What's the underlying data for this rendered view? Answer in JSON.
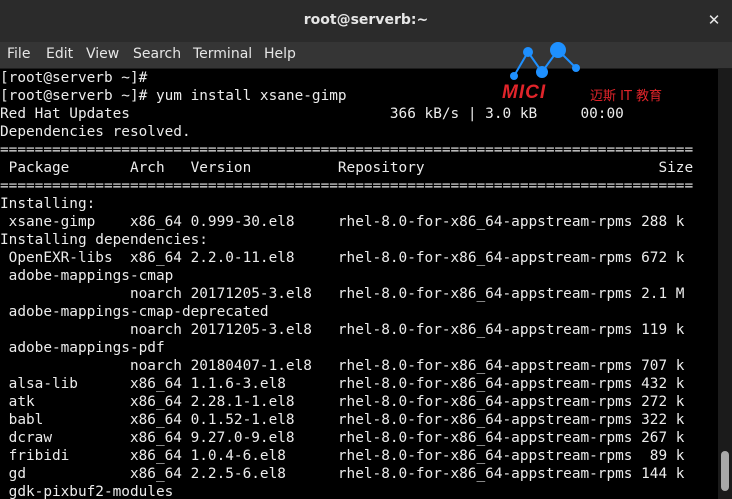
{
  "window": {
    "title": "root@serverb:~",
    "close_icon": "✕"
  },
  "menu": [
    "File",
    "Edit",
    "View",
    "Search",
    "Terminal",
    "Help"
  ],
  "logo": {
    "brand": "MICI",
    "subtitle": "迈斯 IT 教育"
  },
  "terminal_lines": [
    "[root@serverb ~]#",
    "[root@serverb ~]# yum install xsane-gimp",
    "Red Hat Updates                              366 kB/s | 3.0 kB     00:00",
    "Dependencies resolved.",
    "================================================================================",
    " Package       Arch   Version          Repository                           Size",
    "================================================================================",
    "Installing:",
    " xsane-gimp    x86_64 0.999-30.el8     rhel-8.0-for-x86_64-appstream-rpms 288 k",
    "Installing dependencies:",
    " OpenEXR-libs  x86_64 2.2.0-11.el8     rhel-8.0-for-x86_64-appstream-rpms 672 k",
    " adobe-mappings-cmap",
    "               noarch 20171205-3.el8   rhel-8.0-for-x86_64-appstream-rpms 2.1 M",
    " adobe-mappings-cmap-deprecated",
    "               noarch 20171205-3.el8   rhel-8.0-for-x86_64-appstream-rpms 119 k",
    " adobe-mappings-pdf",
    "               noarch 20180407-1.el8   rhel-8.0-for-x86_64-appstream-rpms 707 k",
    " alsa-lib      x86_64 1.1.6-3.el8      rhel-8.0-for-x86_64-appstream-rpms 432 k",
    " atk           x86_64 2.28.1-1.el8     rhel-8.0-for-x86_64-appstream-rpms 272 k",
    " babl          x86_64 0.1.52-1.el8     rhel-8.0-for-x86_64-appstream-rpms 322 k",
    " dcraw         x86_64 9.27.0-9.el8     rhel-8.0-for-x86_64-appstream-rpms 267 k",
    " fribidi       x86_64 1.0.4-6.el8      rhel-8.0-for-x86_64-appstream-rpms  89 k",
    " gd            x86_64 2.2.5-6.el8      rhel-8.0-for-x86_64-appstream-rpms 144 k",
    " gdk-pixbuf2-modules"
  ],
  "colors": {
    "terminal_bg": "#000000",
    "terminal_fg": "#ececec",
    "titlebar_bg": "#2b2b2b",
    "menubar_bg": "#353535",
    "logo_blue": "#1e90ff",
    "logo_red": "#e0242a"
  }
}
